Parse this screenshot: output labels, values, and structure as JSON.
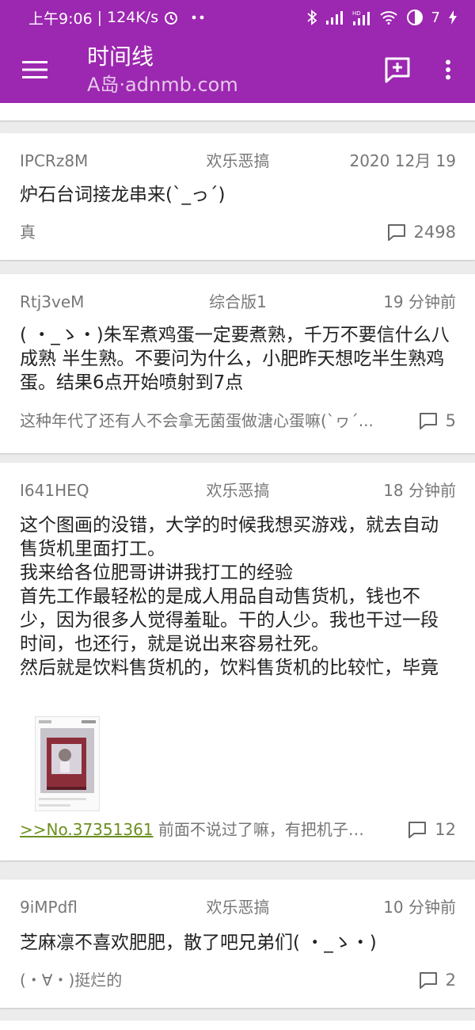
{
  "status": {
    "time": "上午9:06",
    "speed": "124K/s",
    "battery_level": "7"
  },
  "appbar": {
    "title": "时间线",
    "subtitle": "A岛·adnmb.com"
  },
  "posts": [
    {
      "uid": "IPCRz8M",
      "board": "欢乐恶搞",
      "time": "2020 12月 19",
      "content": "炉石台词接龙串来(`_っ´)",
      "footer": "真",
      "replies": "2498"
    },
    {
      "uid": "Rtj3veM",
      "board": "综合版1",
      "time": "19 分钟前",
      "content": "( ・_ゝ・)朱军煮鸡蛋一定要煮熟，千万不要信什么八成熟 半生熟。不要问为什么，小肥昨天想吃半生熟鸡蛋。结果6点开始喷射到7点",
      "footer": "这种年代了还有人不会拿无菌蛋做溏心蛋嘛(`ヮ´...",
      "replies": "5"
    },
    {
      "uid": "I641HEQ",
      "board": "欢乐恶搞",
      "time": "18 分钟前",
      "content": "这个图画的没错，大学的时候我想买游戏，就去自动售货机里面打工。\n我来给各位肥哥讲讲我打工的经验\n首先工作最轻松的是成人用品自动售货机，钱也不少，因为很多人觉得羞耻。干的人少。我也干过一段时间，也还行，就是说出来容易社死。\n然后就是饮料售货机的，饮料售货机的比较忙，毕竟买饮料的人还是挺多的。需要的人也挺多。市中心...",
      "quote_link": ">>No.37351361",
      "footer": "前面不说过了嘛，有把机子整...",
      "replies": "12"
    },
    {
      "uid": "9iMPdfl",
      "board": "欢乐恶搞",
      "time": "10 分钟前",
      "content": "芝麻凛不喜欢肥肥，散了吧兄弟们( ・_ゝ・)",
      "footer": "(・∀・)挺烂的",
      "replies": "2"
    }
  ],
  "colors": {
    "primary": "#9c27b0",
    "link": "#6b8f1f"
  }
}
